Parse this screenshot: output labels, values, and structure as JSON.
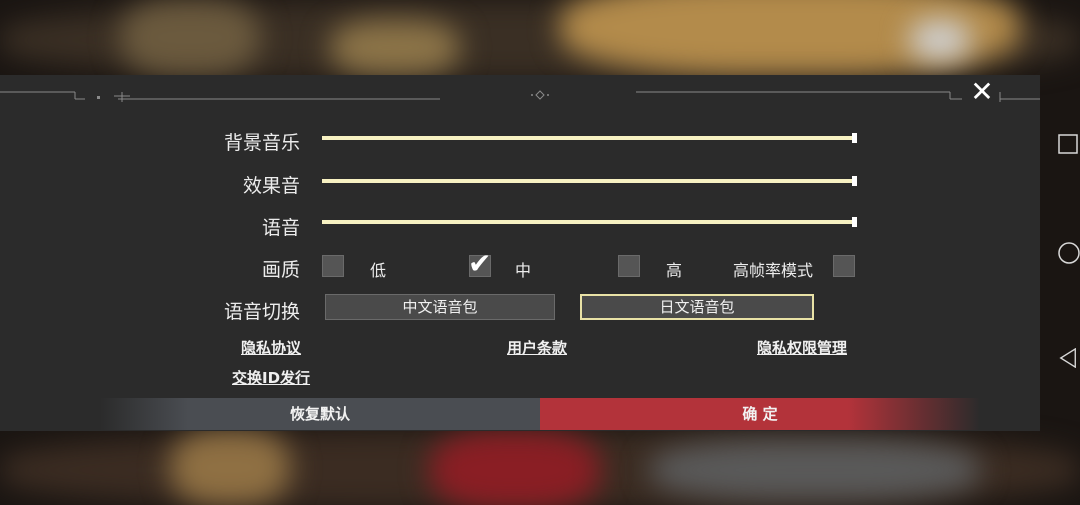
{
  "settings": {
    "bgm_label": "背景音乐",
    "sfx_label": "效果音",
    "voice_label": "语音",
    "quality_label": "画质",
    "quality_options": {
      "low": "低",
      "mid": "中",
      "high": "高"
    },
    "quality_selected": "中",
    "high_fps_label": "高帧率模式",
    "high_fps_enabled": false,
    "bgm_level": 1.0,
    "sfx_level": 1.0,
    "voice_level": 1.0,
    "voice_switch_label": "语音切换",
    "voice_packs": {
      "chinese": "中文语音包",
      "japanese": "日文语音包"
    },
    "voice_pack_selected": "日文语音包"
  },
  "links": {
    "privacy": "隐私协议",
    "user_terms": "用户条款",
    "privacy_permissions": "隐私权限管理",
    "exchange_id": "交换ID发行"
  },
  "buttons": {
    "reset": "恢复默认",
    "confirm": "确 定"
  },
  "colors": {
    "panel": "#2b2b2b",
    "slider": "#f3edb8",
    "confirm": "#b3333a",
    "reset": "#4a4d52",
    "selected_border": "#e9e2a6"
  },
  "icons": {
    "close": "close-icon",
    "nav_square": "square-icon",
    "nav_circle": "circle-icon",
    "nav_back": "triangle-back-icon"
  }
}
